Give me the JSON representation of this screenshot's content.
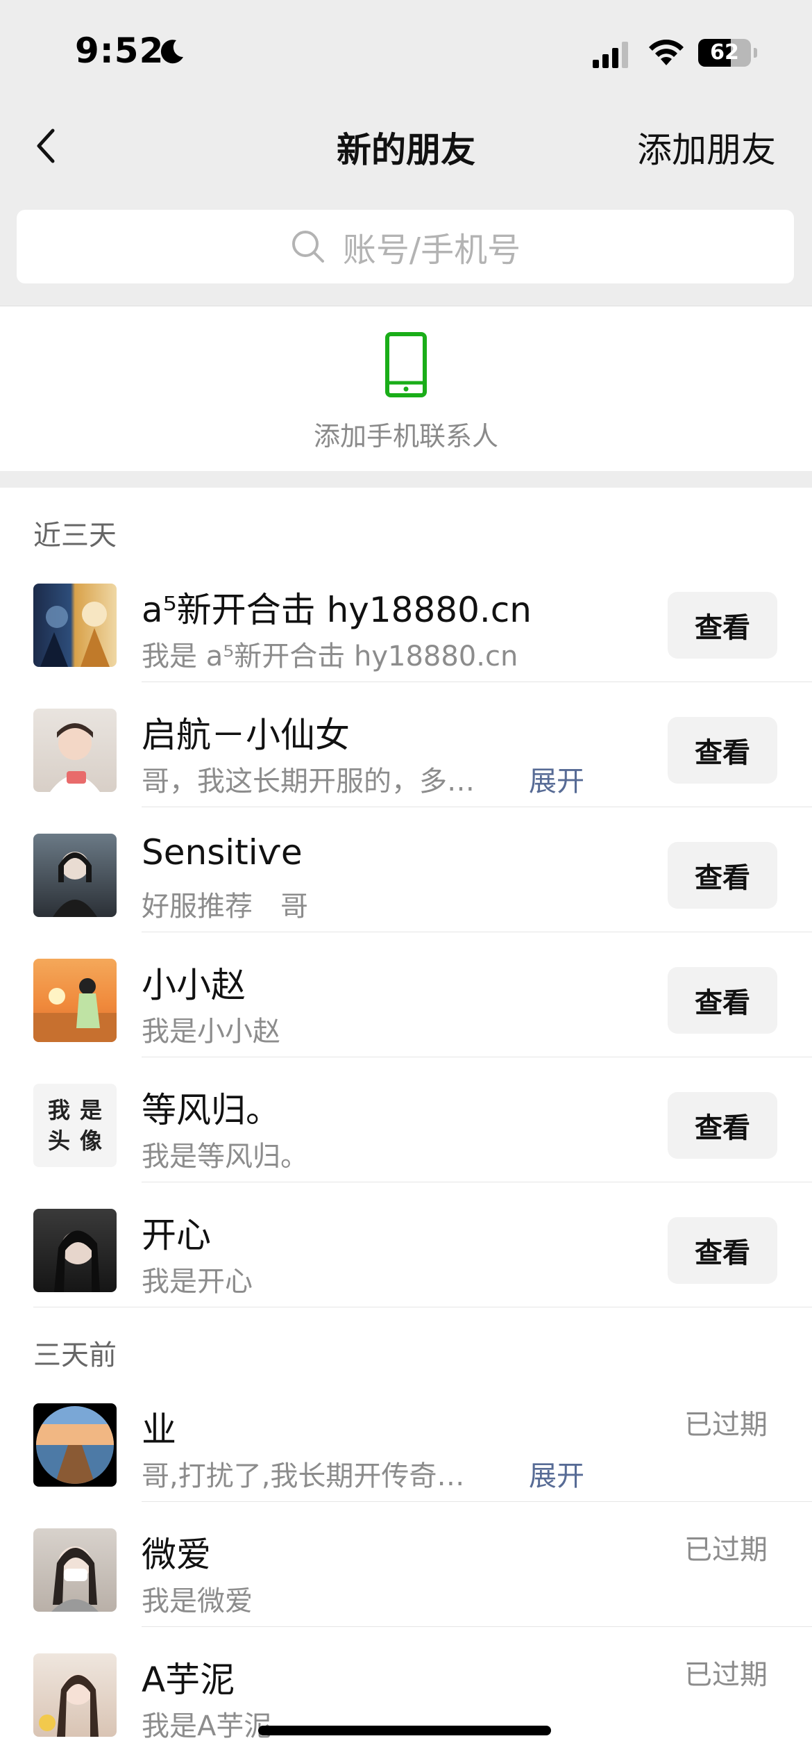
{
  "status_bar": {
    "time": "9:52",
    "battery": "62",
    "battery_level": 0.62
  },
  "nav": {
    "title": "新的朋友",
    "action": "添加朋友"
  },
  "search": {
    "placeholder": "账号/手机号"
  },
  "phone_contacts": {
    "label": "添加手机联系人",
    "icon_color": "#1aad19"
  },
  "sections": [
    {
      "title": "近三天"
    },
    {
      "title": "三天前"
    }
  ],
  "recent": [
    {
      "name": "a⁵新开合击 hy18880.cn",
      "message": "我是 a⁵新开合击 hy18880.cn",
      "button": "查看"
    },
    {
      "name": "启航－小仙女",
      "message": "哥，我这长期开服的，多…",
      "expand": "展开",
      "button": "查看"
    },
    {
      "name": "Sensitiѵe",
      "message": "好服推荐　哥",
      "button": "查看"
    },
    {
      "name": "小小赵",
      "message": "我是小小赵",
      "button": "查看"
    },
    {
      "name": "等风归。",
      "message": "我是等风归。",
      "button": "查看",
      "avatar_text": [
        "我",
        "是",
        "头",
        "像"
      ]
    },
    {
      "name": "开心",
      "message": "我是开心",
      "button": "查看"
    }
  ],
  "older": [
    {
      "name": "业",
      "message": "哥,打扰了,我长期开传奇…",
      "expand": "展开",
      "status": "已过期"
    },
    {
      "name": "微爱",
      "message": "我是微爱",
      "status": "已过期"
    },
    {
      "name": "A芋泥",
      "message": "我是A芋泥",
      "status": "已过期"
    }
  ],
  "colors": {
    "link": "#576b95",
    "accent": "#1aad19",
    "background": "#ededed"
  }
}
